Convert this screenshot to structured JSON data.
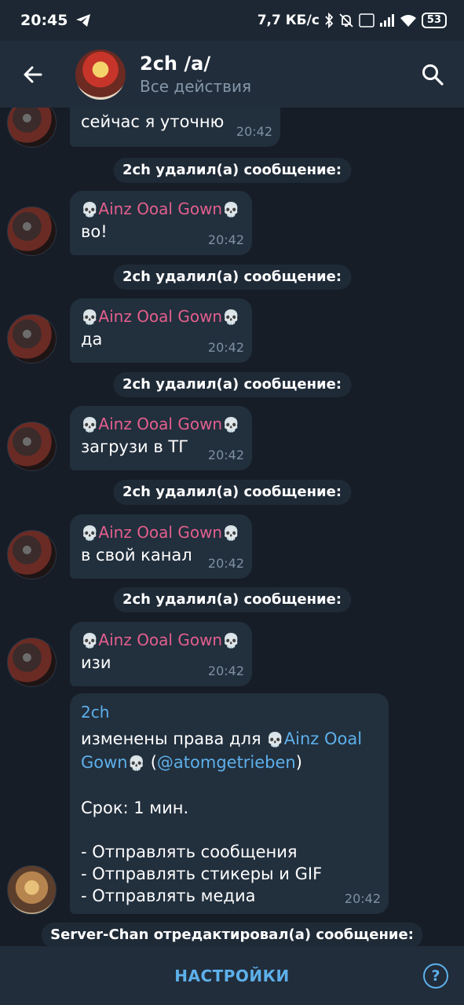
{
  "status_bar": {
    "time": "20:45",
    "network_speed": "7,7 КБ/с",
    "battery": "53"
  },
  "header": {
    "title": "2ch /a/",
    "subtitle": "Все действия",
    "back_icon": "arrow-left-icon",
    "search_icon": "search-icon"
  },
  "messages": [
    {
      "text": "сейчас я уточню",
      "time": "20:42"
    },
    {
      "service": "2ch удалил(а) сообщение:"
    },
    {
      "sender": "Ainz Ooal Gown",
      "text": "во!",
      "time": "20:42"
    },
    {
      "service": "2ch удалил(а) сообщение:"
    },
    {
      "sender": "Ainz Ooal Gown",
      "text": "да",
      "time": "20:42"
    },
    {
      "service": "2ch удалил(а) сообщение:"
    },
    {
      "sender": "Ainz Ooal Gown",
      "text": "загрузи в ТГ",
      "time": "20:42"
    },
    {
      "service": "2ch удалил(а) сообщение:"
    },
    {
      "sender": "Ainz Ooal Gown",
      "text": "в свой канал",
      "time": "20:42"
    },
    {
      "service": "2ch удалил(а) сообщение:"
    },
    {
      "sender": "Ainz Ooal Gown",
      "text": "изи",
      "time": "20:42"
    }
  ],
  "admin_message": {
    "sender": "2ch",
    "line1_prefix": "изменены права для",
    "user_name_1": "Ainz Ooal",
    "user_name_2": "Gown",
    "username": "@atomgetrieben",
    "term": "Срок: 1 мин.",
    "rights": [
      "- Отправлять сообщения",
      "- Отправлять стикеры и GIF",
      "- Отправлять медиа"
    ],
    "time": "20:42"
  },
  "last_service": "Server-Chan отредактировал(а) сообщение:",
  "bottom": {
    "settings_label": "НАСТРОЙКИ",
    "help_label": "?"
  },
  "colors": {
    "background": "#161d27",
    "bubble": "#222f3d",
    "sender_pink": "#e35f8d",
    "accent_blue": "#5db0ea"
  }
}
